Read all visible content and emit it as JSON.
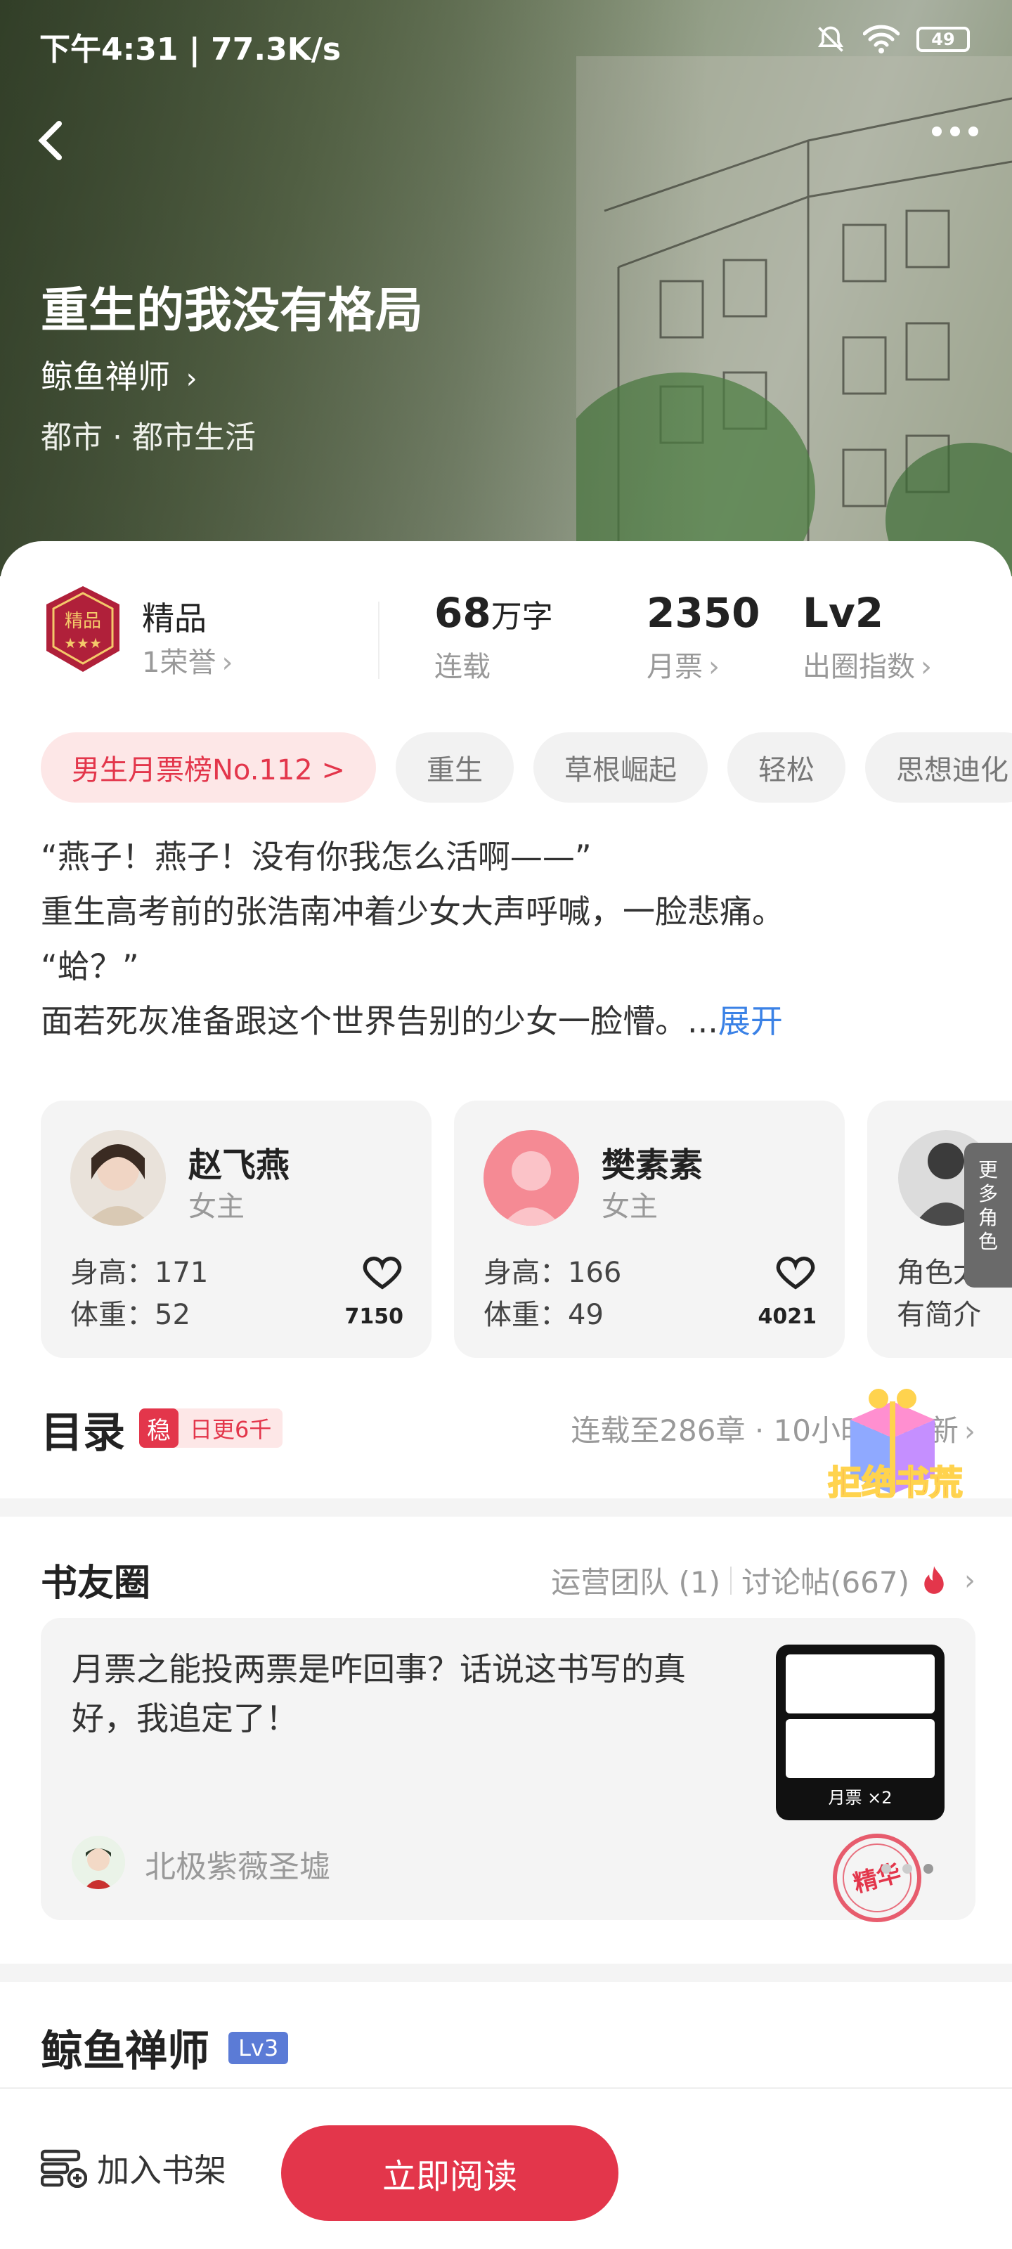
{
  "status_bar": {
    "time": "下午4:31 | 77.3K/s",
    "battery": "49"
  },
  "book": {
    "title": "重生的我没有格局",
    "author": "鲸鱼禅师",
    "genre": "都市 · 都市生活"
  },
  "stats": {
    "quality_label": "精品",
    "honor": "1荣誉",
    "words_value": "68",
    "words_unit": "万字",
    "words_label": "连载",
    "monthly_value": "2350",
    "monthly_label": "月票",
    "level_value": "Lv2",
    "level_label": "出圈指数"
  },
  "tags": [
    "男生月票榜No.112 >",
    "重生",
    "草根崛起",
    "轻松",
    "思想迪化"
  ],
  "synopsis": {
    "lines": [
      "“燕子！燕子！没有你我怎么活啊——”",
      "重生高考前的张浩南冲着少女大声呼喊，一脸悲痛。",
      "“蛤？”",
      "面若死灰准备跟这个世界告别的少女一脸懵。..."
    ],
    "expand": "展开"
  },
  "characters": [
    {
      "name": "赵飞燕",
      "role": "女主",
      "height": "身高：171",
      "weight": "体重：52",
      "likes": "7150"
    },
    {
      "name": "樊素素",
      "role": "女主",
      "height": "身高：166",
      "weight": "体重：49",
      "likes": "4021"
    },
    {
      "line1": "角色太过",
      "line2": "有简介"
    }
  ],
  "more_roles": "更多角色",
  "toc": {
    "title": "目录",
    "badge_steady": "稳",
    "badge_daily": "日更6千",
    "status": "连载至286章 · 10小时前更新"
  },
  "circle": {
    "title": "书友圈",
    "ops_team": "运营团队 (1)",
    "discussions": "讨论帖(667)",
    "post_text": "月票之能投两票是咋回事？话说这书写的真好，我追定了！",
    "post_user": "北极紫薇圣墟",
    "thumb_caption": "月票 ×2",
    "stamp": "精华"
  },
  "promo": {
    "label": "拒绝书荒"
  },
  "author_section": {
    "name": "鲸鱼禅师",
    "level": "Lv3"
  },
  "bottom": {
    "shelf": "加入书架",
    "read": "立即阅读"
  },
  "colors": {
    "accent": "#e3364b",
    "link": "#3b82e6",
    "level": "#5b7bd6"
  }
}
